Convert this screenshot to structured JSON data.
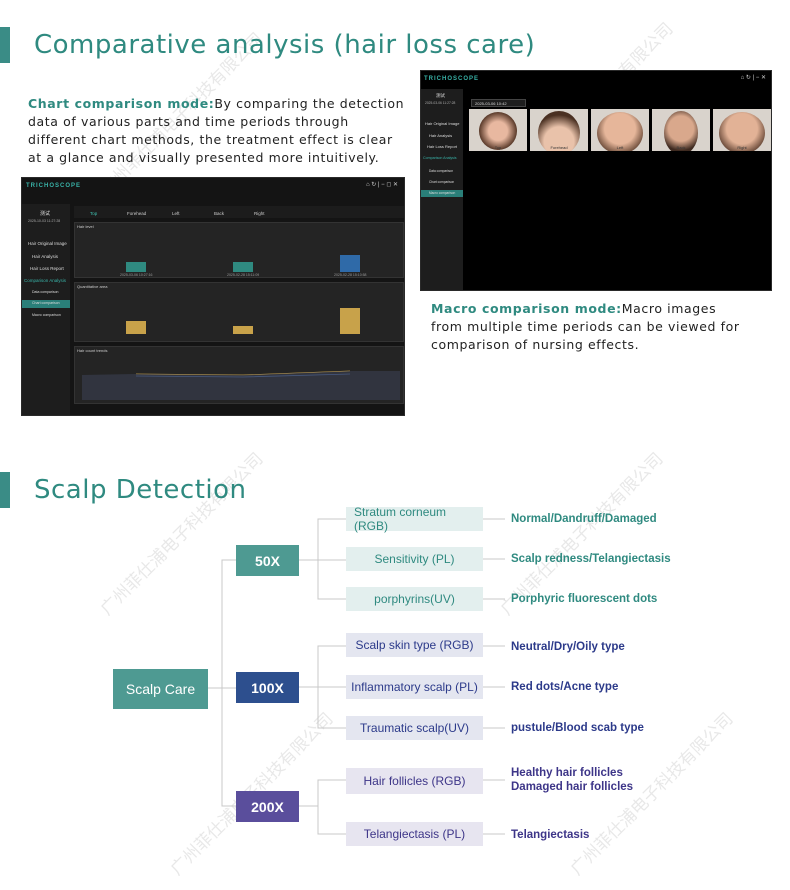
{
  "section1": {
    "title": "Comparative analysis (hair loss care)"
  },
  "chart_mode": {
    "heading": "Chart comparison mode:",
    "text": "By comparing the detection data of various parts and time periods through different chart methods, the treatment effect is clear at a glance and visually presented more intuitively."
  },
  "macro_mode": {
    "heading": "Macro comparison mode:",
    "text": "Macro images from multiple time periods can be viewed for comparison of nursing effects."
  },
  "app1": {
    "brand": "TRICHOSCOPE",
    "user": "测试",
    "date": "2025-10-03 11:27:28",
    "sidebar": [
      "Hair Original Image",
      "Hair Analysis",
      "Hair Loss Report",
      "Comparison Analysis",
      "Data comparison",
      "Chart comparison",
      "Macro comparison"
    ],
    "tabs": [
      "Top",
      "Forehead",
      "Left",
      "Back",
      "Right"
    ],
    "panels": [
      "Hair level",
      "Quantitative area",
      "Hair count trends"
    ],
    "legend1": [
      "Normal",
      "Mild",
      "Moderate",
      "Severe"
    ],
    "dates": [
      "2025-03-06 10:27:16",
      "2025-02-28 15:11:09",
      "2025-02-28 15:10:58"
    ]
  },
  "app2": {
    "brand": "TRICHOSCOPE",
    "user": "测试",
    "date": "2025-03-06 11:27:28",
    "sidebar": [
      "Hair Original Image",
      "Hair Analysis",
      "Hair Loss Report",
      "Comparison Analysis",
      "Data comparison",
      "Chart comparison",
      "Macro comparison"
    ],
    "dropdown": "2025-03-06 10:42",
    "thumbs": [
      "Top",
      "Forehead",
      "Left",
      "Back",
      "Right"
    ]
  },
  "section2": {
    "title": "Scalp Detection"
  },
  "tree": {
    "root": "Scalp Care",
    "levels": [
      {
        "label": "50X",
        "color": "#4e9a92",
        "items": [
          {
            "name": "Stratum corneum\n(RGB)",
            "result": "Normal/Dandruff/Damaged"
          },
          {
            "name": "Sensitivity (PL)",
            "result": "Scalp redness/Telangiectasis"
          },
          {
            "name": "porphyrins(UV)",
            "result": "Porphyric fluorescent dots"
          }
        ]
      },
      {
        "label": "100X",
        "color": "#2d4f8e",
        "items": [
          {
            "name": "Scalp skin type (RGB)",
            "result": "Neutral/Dry/Oily type"
          },
          {
            "name": "Inflammatory scalp (PL)",
            "result": "Red dots/Acne type"
          },
          {
            "name": "Traumatic scalp(UV)",
            "result": "pustule/Blood scab type"
          }
        ]
      },
      {
        "label": "200X",
        "color": "#5a4e9c",
        "items": [
          {
            "name": "Hair follicles (RGB)",
            "result": "Healthy hair follicles\nDamaged hair follicles"
          },
          {
            "name": "Telangiectasis (PL)",
            "result": "Telangiectasis"
          }
        ]
      }
    ]
  },
  "watermark": "广州菲仕浦电子科技有限公司"
}
